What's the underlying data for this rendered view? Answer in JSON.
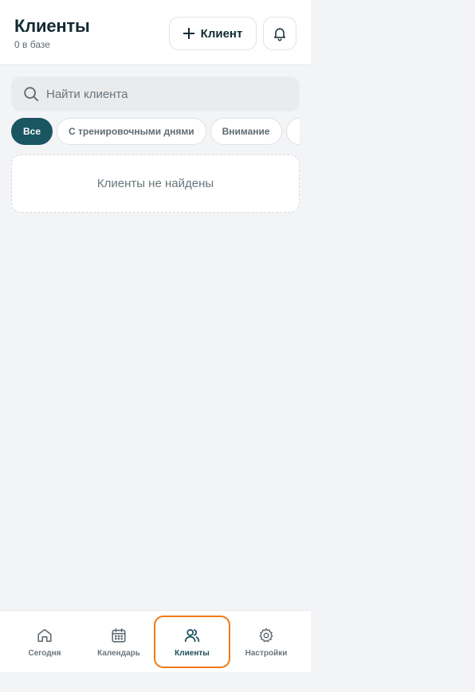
{
  "header": {
    "title": "Клиенты",
    "subtitle": "0 в базе",
    "add_button_label": "Клиент"
  },
  "search": {
    "placeholder": "Найти клиента",
    "value": ""
  },
  "filters": [
    {
      "label": "Все",
      "active": true
    },
    {
      "label": "С тренировочными днями",
      "active": false
    },
    {
      "label": "Внимание",
      "active": false
    }
  ],
  "empty_state": {
    "text": "Клиенты не найдены"
  },
  "tabbar": {
    "items": [
      {
        "label": "Сегодня",
        "icon": "home-icon",
        "active": false
      },
      {
        "label": "Календарь",
        "icon": "calendar-icon",
        "active": false
      },
      {
        "label": "Клиенты",
        "icon": "users-icon",
        "active": true
      },
      {
        "label": "Настройки",
        "icon": "gear-icon",
        "active": false
      }
    ]
  },
  "colors": {
    "accent": "#1a5562",
    "focus_outline": "#f07a13",
    "background": "#f3f4f6"
  }
}
